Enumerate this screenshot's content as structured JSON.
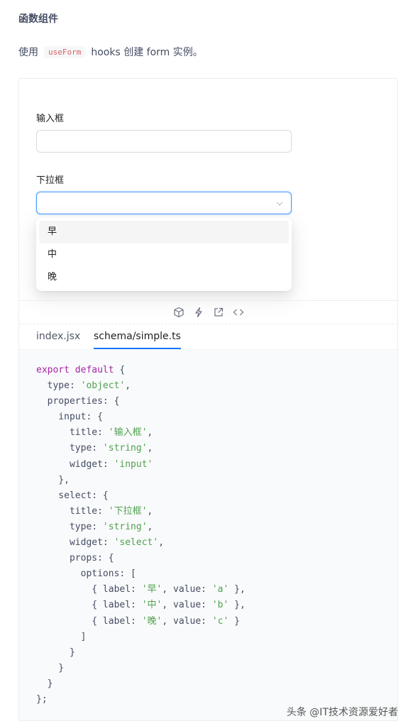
{
  "section": {
    "title": "函数组件",
    "desc_prefix": "使用",
    "desc_code": "useForm",
    "desc_suffix": "hooks 创建 form 实例。"
  },
  "form": {
    "input_label": "输入框",
    "input_value": "",
    "select_label": "下拉框",
    "select_value": "",
    "options": [
      "早",
      "中",
      "晚"
    ],
    "hovered_option": "早"
  },
  "actions": {
    "icons": [
      "codesandbox-icon",
      "codepen-lightning-icon",
      "open-external-icon",
      "code-toggle-icon"
    ]
  },
  "tabs": [
    {
      "label": "index.jsx",
      "active": false
    },
    {
      "label": "schema/simple.ts",
      "active": true
    }
  ],
  "code": {
    "lines": [
      [
        {
          "t": "kw",
          "v": "export default"
        },
        {
          "t": "plain",
          "v": " {"
        }
      ],
      [
        {
          "t": "plain",
          "v": "  type: "
        },
        {
          "t": "str",
          "v": "'object'"
        },
        {
          "t": "plain",
          "v": ","
        }
      ],
      [
        {
          "t": "plain",
          "v": "  properties: {"
        }
      ],
      [
        {
          "t": "plain",
          "v": "    input: {"
        }
      ],
      [
        {
          "t": "plain",
          "v": "      title: "
        },
        {
          "t": "str",
          "v": "'输入框'"
        },
        {
          "t": "plain",
          "v": ","
        }
      ],
      [
        {
          "t": "plain",
          "v": "      type: "
        },
        {
          "t": "str",
          "v": "'string'"
        },
        {
          "t": "plain",
          "v": ","
        }
      ],
      [
        {
          "t": "plain",
          "v": "      widget: "
        },
        {
          "t": "str",
          "v": "'input'"
        }
      ],
      [
        {
          "t": "plain",
          "v": "    },"
        }
      ],
      [
        {
          "t": "plain",
          "v": "    select: {"
        }
      ],
      [
        {
          "t": "plain",
          "v": "      title: "
        },
        {
          "t": "str",
          "v": "'下拉框'"
        },
        {
          "t": "plain",
          "v": ","
        }
      ],
      [
        {
          "t": "plain",
          "v": "      type: "
        },
        {
          "t": "str",
          "v": "'string'"
        },
        {
          "t": "plain",
          "v": ","
        }
      ],
      [
        {
          "t": "plain",
          "v": "      widget: "
        },
        {
          "t": "str",
          "v": "'select'"
        },
        {
          "t": "plain",
          "v": ","
        }
      ],
      [
        {
          "t": "plain",
          "v": "      props: {"
        }
      ],
      [
        {
          "t": "plain",
          "v": "        options: ["
        }
      ],
      [
        {
          "t": "plain",
          "v": "          { label: "
        },
        {
          "t": "str",
          "v": "'早'"
        },
        {
          "t": "plain",
          "v": ", value: "
        },
        {
          "t": "str",
          "v": "'a'"
        },
        {
          "t": "plain",
          "v": " },"
        }
      ],
      [
        {
          "t": "plain",
          "v": "          { label: "
        },
        {
          "t": "str",
          "v": "'中'"
        },
        {
          "t": "plain",
          "v": ", value: "
        },
        {
          "t": "str",
          "v": "'b'"
        },
        {
          "t": "plain",
          "v": " },"
        }
      ],
      [
        {
          "t": "plain",
          "v": "          { label: "
        },
        {
          "t": "str",
          "v": "'晚'"
        },
        {
          "t": "plain",
          "v": ", value: "
        },
        {
          "t": "str",
          "v": "'c'"
        },
        {
          "t": "plain",
          "v": " }"
        }
      ],
      [
        {
          "t": "plain",
          "v": "        ]"
        }
      ],
      [
        {
          "t": "plain",
          "v": "      }"
        }
      ],
      [
        {
          "t": "plain",
          "v": "    }"
        }
      ],
      [
        {
          "t": "plain",
          "v": "  }"
        }
      ],
      [
        {
          "t": "plain",
          "v": "};"
        }
      ]
    ]
  },
  "watermark": "头条 @IT技术资源爱好者",
  "colors": {
    "keyword": "#a626a4",
    "string": "#50a14f",
    "active_tab_underline": "#1677ff",
    "select_focus_border": "#4096ff",
    "inline_code": "#d56161"
  }
}
